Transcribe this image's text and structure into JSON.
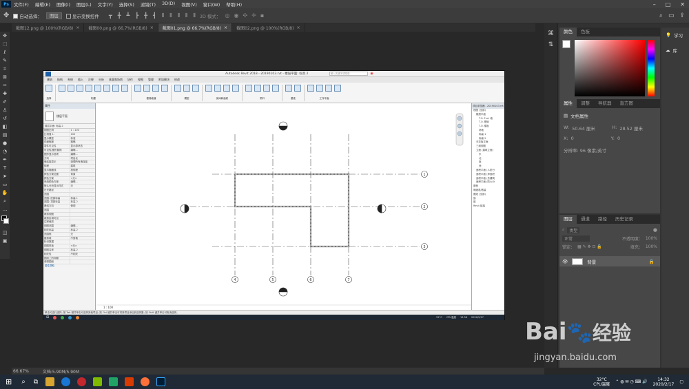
{
  "menubar": {
    "logo": "Ps",
    "items": [
      "文件(F)",
      "编辑(E)",
      "图像(I)",
      "图层(L)",
      "文字(Y)",
      "选择(S)",
      "滤镜(T)",
      "3D(D)",
      "视图(V)",
      "窗口(W)",
      "帮助(H)"
    ]
  },
  "options": {
    "auto_select_label": "自动选择：",
    "auto_select_value": "图层",
    "show_transform_label": "显示变换控件",
    "mode_3d": "3D 模式："
  },
  "doc_tabs": [
    {
      "label": "截图12.png @ 100%(RGB/8)",
      "active": false
    },
    {
      "label": "截图00.png @ 66.7%(RGB/8)",
      "active": false
    },
    {
      "label": "截图01.png @ 66.7%(RGB/8)",
      "active": true
    },
    {
      "label": "截图02.png @ 100%(RGB/8)",
      "active": false
    }
  ],
  "revit": {
    "window_title": "Autodesk Revit 2018 -    20190103.rvt - 楼层平面: 标高 2",
    "search_placeholder": "键入关键字或短语",
    "ribbon_tabs": [
      "建筑",
      "结构",
      "系统",
      "插入",
      "注释",
      "分析",
      "体量和场地",
      "协作",
      "视图",
      "管理",
      "附加模块",
      "修改"
    ],
    "ribbon_groups": [
      "选择",
      "构建",
      "楼梯坡道",
      "模型",
      "房间和面积",
      "洞口",
      "基准",
      "工作平面"
    ],
    "props_title": "属性",
    "props_type": "楼层平面",
    "props_selector": "楼层平面: 标高 2",
    "props_rows": [
      [
        "视图比例",
        "1 : 100"
      ],
      [
        "比例值 1:",
        "100"
      ],
      [
        "显示模型",
        "标准"
      ],
      [
        "详细程度",
        "粗略"
      ],
      [
        "零件可见性",
        "显示原状态"
      ],
      [
        "可见性/图形替换",
        "编辑..."
      ],
      [
        "图形显示选项",
        "编辑..."
      ],
      [
        "方向",
        "项目北"
      ],
      [
        "墙连接显示",
        "清理所有墙连接"
      ],
      [
        "规程",
        "建筑"
      ],
      [
        "显示隐藏线",
        "按规程"
      ],
      [
        "颜色方案位置",
        "背景"
      ],
      [
        "颜色方案",
        "<无>"
      ],
      [
        "系统颜色方案",
        "编辑..."
      ],
      [
        "默认分析显示样式",
        "无"
      ],
      [
        "日光路径",
        ""
      ],
      [
        "范围",
        ""
      ],
      [
        "范围: 底部标高",
        "标高 1"
      ],
      [
        "范围: 顶部标高",
        "标高 2"
      ],
      [
        "基线方向",
        "俯视"
      ],
      [
        "范围",
        ""
      ],
      [
        "裁剪视图",
        ""
      ],
      [
        "裁剪区域可见",
        ""
      ],
      [
        "注释裁剪",
        ""
      ],
      [
        "视图范围",
        "编辑..."
      ],
      [
        "相关标高",
        "标高 2"
      ],
      [
        "范围框",
        "无"
      ],
      [
        "截剪裁",
        "不剪裁"
      ],
      [
        "标识数据",
        ""
      ],
      [
        "视图样板",
        "<无>"
      ],
      [
        "视图名称",
        "标高 2"
      ],
      [
        "相关性",
        "不相关"
      ],
      [
        "图纸上的标题",
        ""
      ],
      [
        "参照图纸",
        ""
      ]
    ],
    "props_footer": "属性帮助",
    "browser_title": "项目浏览器 - 20190103.rvt",
    "browser_items": [
      "视图 (全部)",
      "楼层平面",
      "T.O. Fnd. 墙",
      "T.O. 基础",
      "T.O. 楼板",
      "场地",
      "标高 1",
      "标高 2",
      "天花板平面",
      "三维视图",
      "立面 (建筑立面)",
      "东",
      "北",
      "南",
      "西",
      "面积平面 (人防分",
      "面积平面 (净面积",
      "面积平面 (总建筑",
      "面积平面 (防火分",
      "图例",
      "明细表/数量",
      "图纸 (全部)",
      "族",
      "组",
      "Revit 链接"
    ],
    "scale": "1 : 100",
    "status_text": "单击可进行选择; 按 Tab 键并单击可选择其他项目; 按 Ctrl 键并单击可将新项目添加到选择集; 按 Shift 键并单击可取消选择。",
    "status_model": "主模型",
    "axis_labels_right": [
      "1",
      "2",
      "3"
    ],
    "axis_labels_bottom": [
      "4",
      "5",
      "6",
      "7"
    ],
    "taskbar_temp": "22°C",
    "taskbar_cpu": "CPU温度",
    "taskbar_time": "13:56",
    "taskbar_date": "2020/2/17"
  },
  "color_panel": {
    "tabs": [
      "颜色",
      "色板"
    ]
  },
  "props_panel": {
    "tabs": [
      "属性",
      "调整",
      "导航器",
      "直方图"
    ],
    "doc_props": "文档属性",
    "w_label": "W:",
    "w_value": "50.64 厘米",
    "h_label": "H:",
    "h_value": "28.52 厘米",
    "x_label": "X:",
    "x_value": "0",
    "y_label": "Y:",
    "y_value": "0",
    "resolution": "分辨率: 96 像素/英寸"
  },
  "layers_panel": {
    "tabs": [
      "图层",
      "通道",
      "路径",
      "历史记录"
    ],
    "kind": "类型",
    "blend": "正常",
    "opacity_label": "不透明度：",
    "opacity_value": "100%",
    "lock_label": "锁定：",
    "fill_label": "填充：",
    "fill_value": "100%",
    "layer_name": "背景"
  },
  "learn_panel": {
    "learn": "学习",
    "library": "库"
  },
  "ps_status": {
    "zoom": "66.67%",
    "doc": "文档:5.90M/5.90M"
  },
  "taskbar": {
    "temp": "32°C",
    "cpu": "CPU温度",
    "time": "14:32",
    "date": "2020/2/17"
  },
  "watermark": {
    "line1": "Bai",
    "line2": "经验",
    "url": "jingyan.baidu.com"
  },
  "colors": {
    "accent": "#31a8ff",
    "fg": "#ffffff",
    "bg": "#000000",
    "ps_bg": "#282828",
    "panel": "#474747"
  }
}
